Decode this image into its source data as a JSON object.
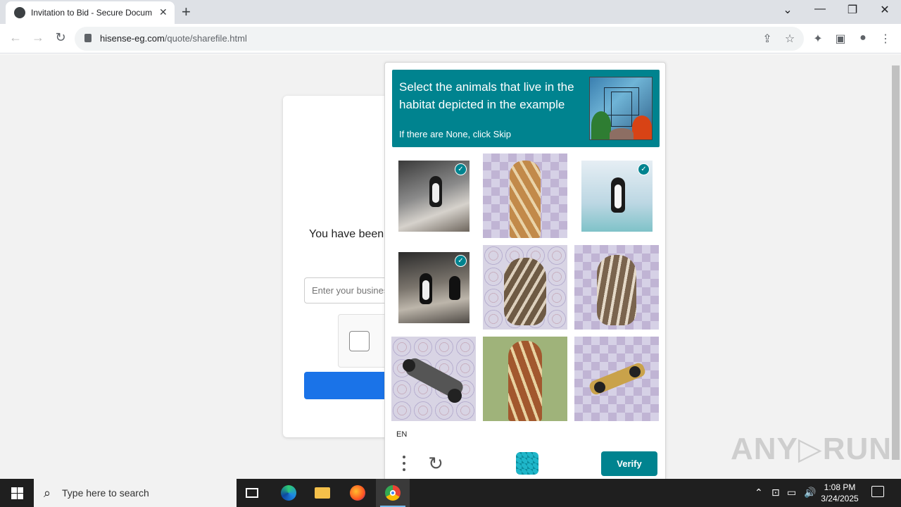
{
  "browser": {
    "tab_title": "Invitation to Bid - Secure Docum",
    "tab_close": "✕",
    "new_tab": "+",
    "url_domain": "hisense-eg.com",
    "url_path": "/quote/sharefile.html",
    "window_controls": {
      "tab_search": "⌄",
      "minimize": "—",
      "restore": "❐",
      "close": "✕"
    }
  },
  "page": {
    "heading": "You have been",
    "email_placeholder": "Enter your business email"
  },
  "captcha": {
    "prompt_main": "Select the animals that live in the habitat depicted in the example",
    "prompt_sub": "If there are None, click Skip",
    "example_icon": "underwater-aquarium-scene",
    "tiles": [
      {
        "subject": "penguin",
        "selected": true
      },
      {
        "subject": "giraffe",
        "selected": false
      },
      {
        "subject": "penguin",
        "selected": true
      },
      {
        "subject": "penguin",
        "selected": true
      },
      {
        "subject": "giraffe",
        "selected": false
      },
      {
        "subject": "giraffe",
        "selected": false
      },
      {
        "subject": "race-car",
        "selected": false
      },
      {
        "subject": "giraffe",
        "selected": false
      },
      {
        "subject": "race-car",
        "selected": false
      }
    ],
    "language": "EN",
    "verify_label": "Verify",
    "accent": "#00838f"
  },
  "watermark": "ANY▷RUN",
  "taskbar": {
    "search_placeholder": "Type here to search",
    "time": "1:08 PM",
    "date": "3/24/2025"
  }
}
